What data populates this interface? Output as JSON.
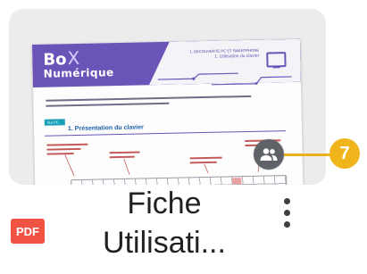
{
  "thumbnail": {
    "logo": {
      "box": "Bo",
      "x": "X",
      "numerique": "Numérique"
    },
    "doc_title": {
      "line1": "1. DÉCOUVERTE PC ET SMARTPHONE",
      "line2": "1. Utilisation du clavier"
    },
    "section": {
      "tag": "Sur PC",
      "title": "1. Présentation du clavier"
    }
  },
  "shared_badge": {
    "icon": "people-icon"
  },
  "callout": {
    "number": "7",
    "color": "#f0b51d"
  },
  "file": {
    "type_label": "PDF",
    "type_color": "#f05244",
    "name_line1": "Fiche",
    "name_line2": "Utilisati..."
  },
  "more_menu": {
    "icon": "more-vert-icon"
  }
}
